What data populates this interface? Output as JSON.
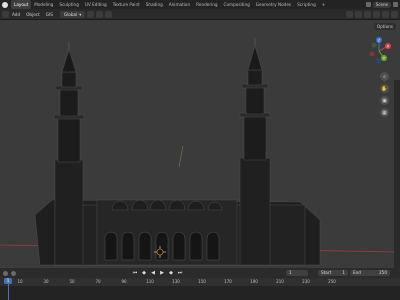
{
  "topbar": {
    "workspaces": [
      "Layout",
      "Modeling",
      "Sculpting",
      "UV Editing",
      "Texture Paint",
      "Shading",
      "Animation",
      "Rendering",
      "Compositing",
      "Geometry Nodes",
      "Scripting"
    ],
    "add_tab": "+",
    "scene": "Scene"
  },
  "header": {
    "menus": [
      "Add",
      "Object",
      "GIS"
    ],
    "transform": "Global",
    "options": "Options"
  },
  "gizmo": {
    "x": "X",
    "y": "Y",
    "z": "Z"
  },
  "timeline": {
    "ticks": [
      "0",
      "10",
      "30",
      "50",
      "70",
      "90",
      "110",
      "130",
      "150",
      "170",
      "190",
      "210",
      "230",
      "250"
    ],
    "current_frame": "1",
    "start_label": "Start",
    "start_value": "1",
    "end_label": "End",
    "end_value": "250",
    "playhead_label": "1"
  },
  "colors": {
    "accent": "#4772b3",
    "viewport": "#3b3b3b"
  }
}
